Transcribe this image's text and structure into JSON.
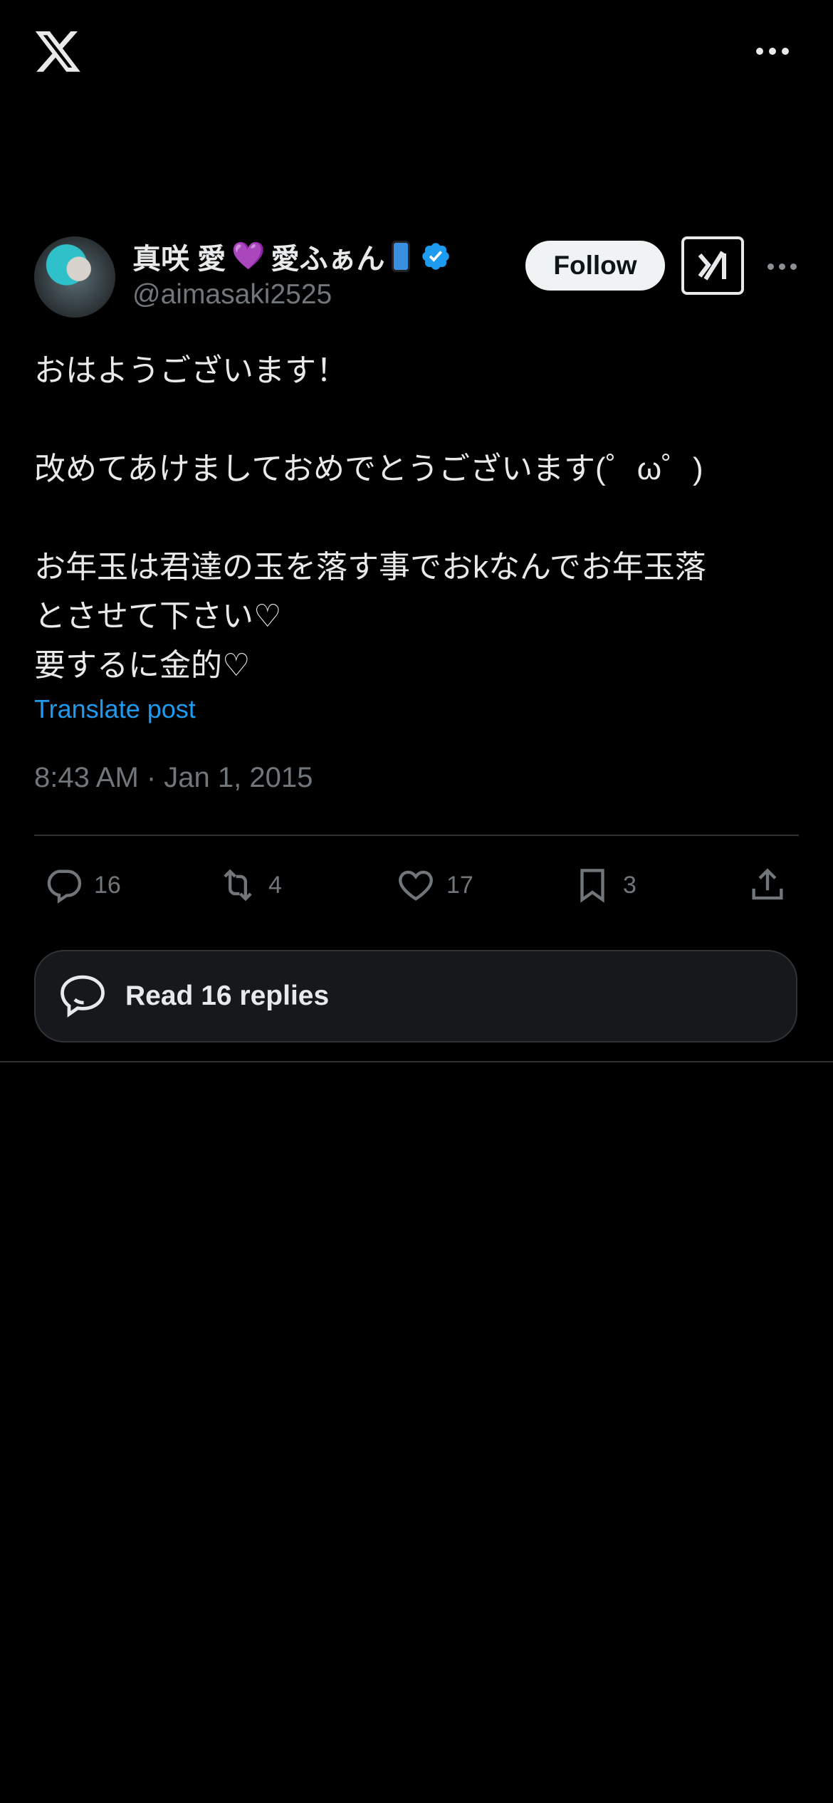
{
  "header": {
    "logo_icon": "x-logo-icon",
    "more_icon": "more-horizontal-icon"
  },
  "post": {
    "author": {
      "display_name_part1": "真咲 愛",
      "heart_emoji": "💜",
      "display_name_part2": "愛ふぁん",
      "phone_emoji_icon": "mobile-phone-icon",
      "verified_icon": "verified-badge-icon",
      "handle": "@aimasaki2525"
    },
    "follow_label": "Follow",
    "grok_icon": "grok-icon",
    "text": "おはようございます！\n\n改めてあけましておめでとうございます(゜ω゜)\n\nお年玉は君達の玉を落す事でおkなんでお年玉落\nとさせて下さい♡\n要するに金的♡",
    "translate_label": "Translate post",
    "timestamp": "8:43 AM · Jan 1, 2015",
    "actions": {
      "replies": "16",
      "reposts": "4",
      "likes": "17",
      "bookmarks": "3"
    },
    "read_replies_label": "Read 16 replies"
  },
  "colors": {
    "background": "#000000",
    "link": "#1d9bf0",
    "verified": "#1d9bf0",
    "muted": "#71767b"
  }
}
